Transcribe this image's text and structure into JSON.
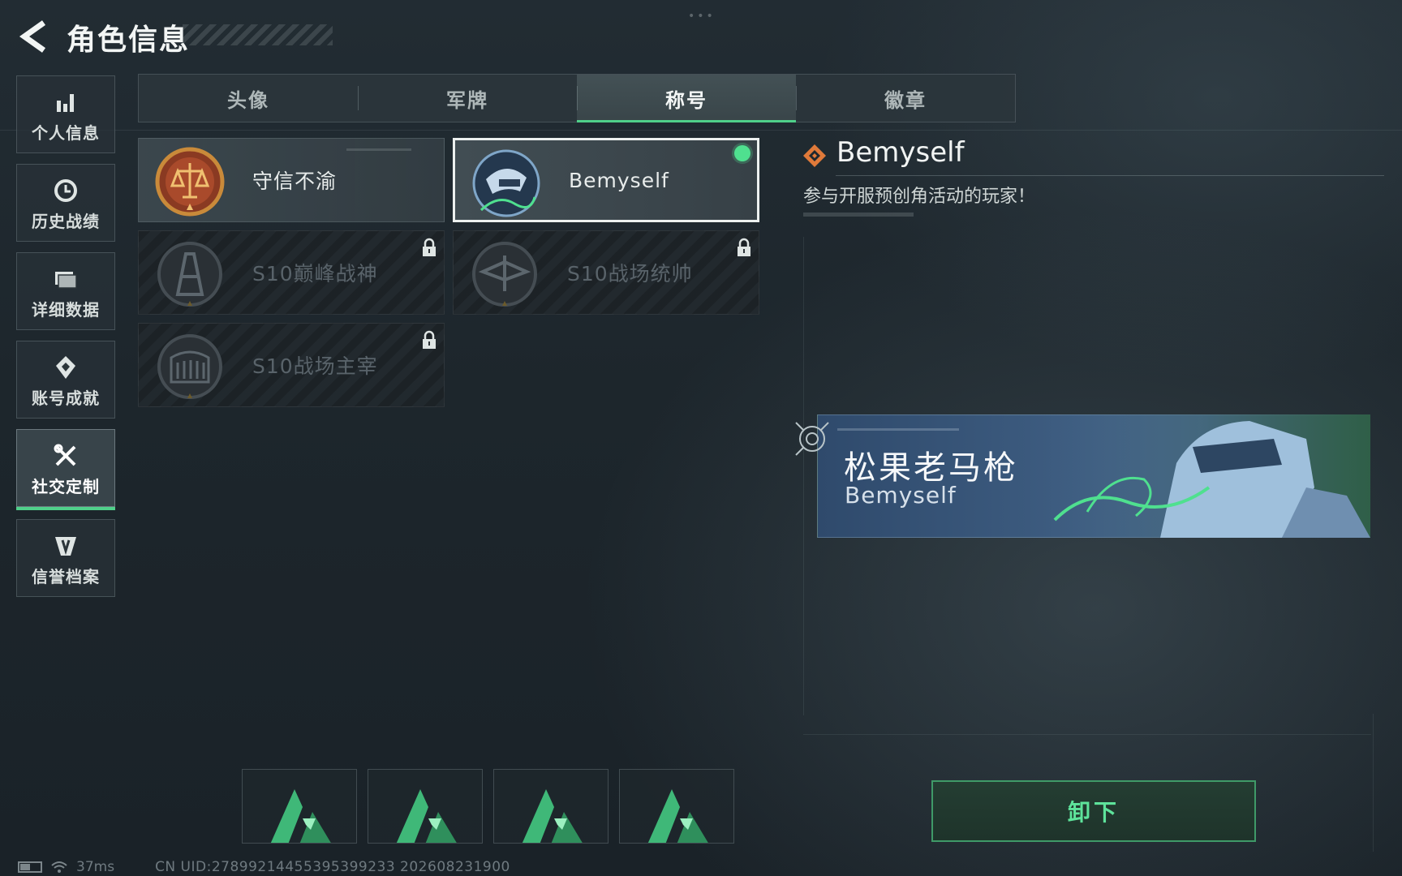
{
  "header": {
    "title": "角色信息",
    "back_icon": "back-arrow-icon"
  },
  "sidebar": {
    "items": [
      {
        "label": "个人信息",
        "icon": "bar-chart-icon",
        "active": false
      },
      {
        "label": "历史战绩",
        "icon": "history-clock-icon",
        "active": false
      },
      {
        "label": "详细数据",
        "icon": "folder-icon",
        "active": false
      },
      {
        "label": "账号成就",
        "icon": "achievement-badge-icon",
        "active": false
      },
      {
        "label": "社交定制",
        "icon": "tools-icon",
        "active": true
      },
      {
        "label": "信誉档案",
        "icon": "reputation-shield-icon",
        "active": false
      }
    ]
  },
  "tabs": [
    {
      "label": "头像",
      "active": false
    },
    {
      "label": "军牌",
      "active": false
    },
    {
      "label": "称号",
      "active": true
    },
    {
      "label": "徽章",
      "active": false
    }
  ],
  "titles": [
    {
      "name": "守信不渝",
      "locked": false,
      "selected": false,
      "emblem": "scales-emblem-icon"
    },
    {
      "name": "Bemyself",
      "locked": false,
      "selected": true,
      "equipped": true,
      "emblem": "bemyself-emblem-icon"
    },
    {
      "name": "S10巅峰战神",
      "locked": true,
      "selected": false,
      "emblem": "tower-emblem-icon"
    },
    {
      "name": "S10战场统帅",
      "locked": true,
      "selected": false,
      "emblem": "aircraft-emblem-icon"
    },
    {
      "name": "S10战场主宰",
      "locked": true,
      "selected": false,
      "emblem": "colosseum-emblem-icon"
    }
  ],
  "detail": {
    "name": "Bemyself",
    "description": "参与开服预创角活动的玩家！",
    "icon": "diamond-rank-icon"
  },
  "banner": {
    "player_name": "松果老马枪",
    "title": "Bemyself",
    "target_icon": "target-reticle-icon"
  },
  "bottom_slots": [
    {
      "icon": "green-a-logo-icon"
    },
    {
      "icon": "green-a-logo-icon"
    },
    {
      "icon": "green-a-logo-icon"
    },
    {
      "icon": "green-a-logo-icon"
    }
  ],
  "action": {
    "unequip_label": "卸下"
  },
  "status": {
    "ping": "37ms",
    "uid": "CN UID:27899214455395399233 202608231900"
  },
  "colors": {
    "accent_green": "#4fd08a",
    "button_text": "#5ee39b",
    "banner_blue": "#3d5c80"
  }
}
